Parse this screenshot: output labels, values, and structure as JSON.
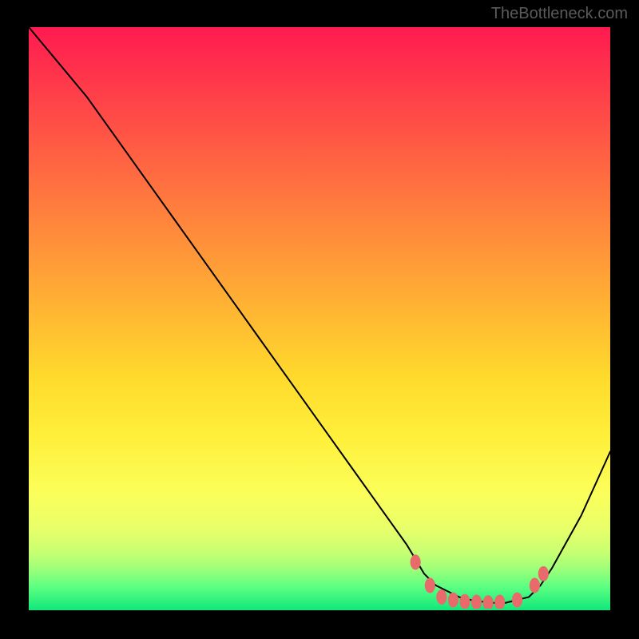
{
  "watermark": "TheBottleneck.com",
  "chart_data": {
    "type": "line",
    "title": "",
    "xlabel": "",
    "ylabel": "",
    "xlim": [
      0,
      100
    ],
    "ylim": [
      0,
      100
    ],
    "series": [
      {
        "name": "curve",
        "x": [
          0,
          5,
          10,
          15,
          20,
          25,
          30,
          35,
          40,
          45,
          50,
          55,
          60,
          65,
          68,
          70,
          72,
          74,
          76,
          78,
          80,
          82,
          84,
          86,
          88,
          90,
          95,
          100
        ],
        "y": [
          100,
          94,
          88,
          81,
          74,
          67,
          60,
          53,
          46,
          39,
          32,
          25,
          18,
          11,
          6,
          4,
          3,
          2,
          1.5,
          1.2,
          1,
          1,
          1.5,
          2,
          4,
          7,
          16,
          27
        ]
      }
    ],
    "markers": {
      "name": "dots",
      "color": "#e86a6a",
      "x": [
        66.5,
        69,
        71,
        73,
        75,
        77,
        79,
        81,
        84,
        87,
        88.5
      ],
      "y": [
        8,
        4,
        2,
        1.5,
        1.2,
        1.1,
        1.0,
        1.1,
        1.5,
        4,
        6
      ]
    },
    "background": {
      "type": "vertical-gradient",
      "top_color": "#ff1a50",
      "bottom_color": "#10e87a"
    }
  }
}
